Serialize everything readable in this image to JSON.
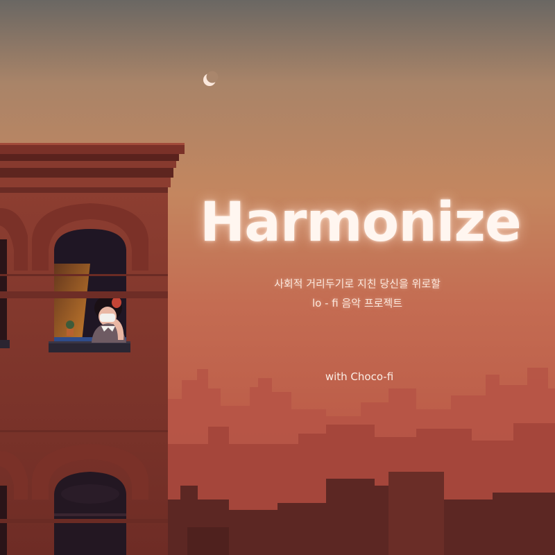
{
  "title": "Harmonize",
  "subtitle_line1": "사회적 거리두기로 지친 당신을 위로할",
  "subtitle_line2": "lo - fi 음악 프로젝트",
  "credit": "with Choco-fi",
  "colors": {
    "sky_top": "#6c6762",
    "sky_mid": "#c88660",
    "sky_low": "#c0614d",
    "building": "#83382d",
    "title_text": "#fff6f0"
  },
  "icons": [
    "crescent-moon-icon",
    "potted-plant-icon"
  ]
}
